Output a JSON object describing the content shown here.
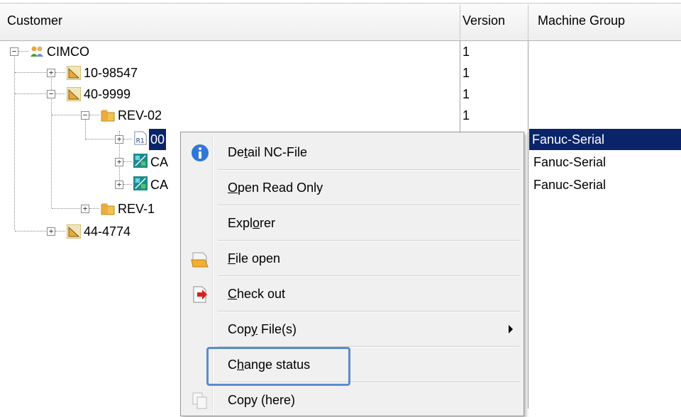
{
  "columns": {
    "customer": "Customer",
    "version": "Version",
    "machine_group": "Machine Group"
  },
  "tree": [
    {
      "label": "CIMCO",
      "version": "1",
      "machine_group": "",
      "icon": "people-icon"
    },
    {
      "label": "10-98547",
      "version": "1",
      "machine_group": "",
      "icon": "set-square-icon"
    },
    {
      "label": "40-9999",
      "version": "1",
      "machine_group": "",
      "icon": "set-square-icon"
    },
    {
      "label": "REV-02",
      "version": "1",
      "machine_group": "",
      "icon": "folder-icon"
    },
    {
      "label": "00",
      "version": "",
      "machine_group": "Fanuc-Serial",
      "icon": "nc-file-icon",
      "selected": true
    },
    {
      "label": "CA",
      "version": "",
      "machine_group": "Fanuc-Serial",
      "icon": "cam-file-icon"
    },
    {
      "label": "CA",
      "version": "",
      "machine_group": "Fanuc-Serial",
      "icon": "cam-file-icon"
    },
    {
      "label": "REV-1",
      "version": "",
      "machine_group": "",
      "icon": "folder-icon"
    },
    {
      "label": "44-4774",
      "version": "",
      "machine_group": "",
      "icon": "set-square-icon"
    }
  ],
  "context_menu": {
    "items": [
      {
        "pre": "De",
        "accel": "t",
        "post": "ail NC-File",
        "icon": "info-icon"
      },
      {
        "pre": "",
        "accel": "O",
        "post": "pen Read Only",
        "icon": ""
      },
      {
        "pre": "Expl",
        "accel": "o",
        "post": "rer",
        "icon": ""
      },
      {
        "pre": "",
        "accel": "F",
        "post": "ile open",
        "icon": "open-folder-icon"
      },
      {
        "pre": "",
        "accel": "C",
        "post": "heck out",
        "icon": "check-out-icon"
      },
      {
        "pre": "Cop",
        "accel": "y",
        "post": " File(s)",
        "icon": "",
        "submenu": true
      },
      {
        "pre": "C",
        "accel": "h",
        "post": "ange status",
        "icon": "",
        "highlighted": true
      },
      {
        "pre": "Copy (here)",
        "accel": "",
        "post": "",
        "icon": "copy-icon"
      }
    ]
  },
  "colors": {
    "selection": "#0a246a",
    "highlight_box": "#5b8ccf"
  }
}
